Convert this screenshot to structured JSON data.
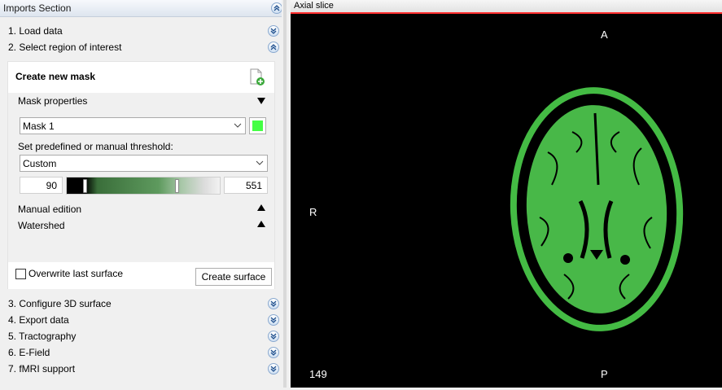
{
  "left_panel": {
    "header_title": "Imports Section",
    "sections": [
      {
        "label": "1. Load data"
      },
      {
        "label": "2. Select region of interest"
      },
      {
        "label": "3. Configure 3D surface"
      },
      {
        "label": "4. Export data"
      },
      {
        "label": "5. Tractography"
      },
      {
        "label": "6. E-Field"
      },
      {
        "label": "7. fMRI support"
      }
    ],
    "mask_panel": {
      "title": "Create new mask",
      "mask_properties_label": "Mask properties",
      "mask_select_value": "Mask 1",
      "mask_color": "#44ff44",
      "threshold_label": "Set predefined or manual threshold:",
      "threshold_select_value": "Custom",
      "threshold_min": "90",
      "threshold_max": "551",
      "manual_edition_label": "Manual edition",
      "watershed_label": "Watershed",
      "overwrite_label": "Overwrite last surface",
      "create_surface_label": "Create surface"
    }
  },
  "viewer": {
    "title": "Axial slice",
    "orientation": {
      "top": "A",
      "left": "R",
      "bottom": "P"
    },
    "slice_number": "149",
    "accent_color": "#ff3030",
    "mask_overlay_color": "#44bb44"
  }
}
